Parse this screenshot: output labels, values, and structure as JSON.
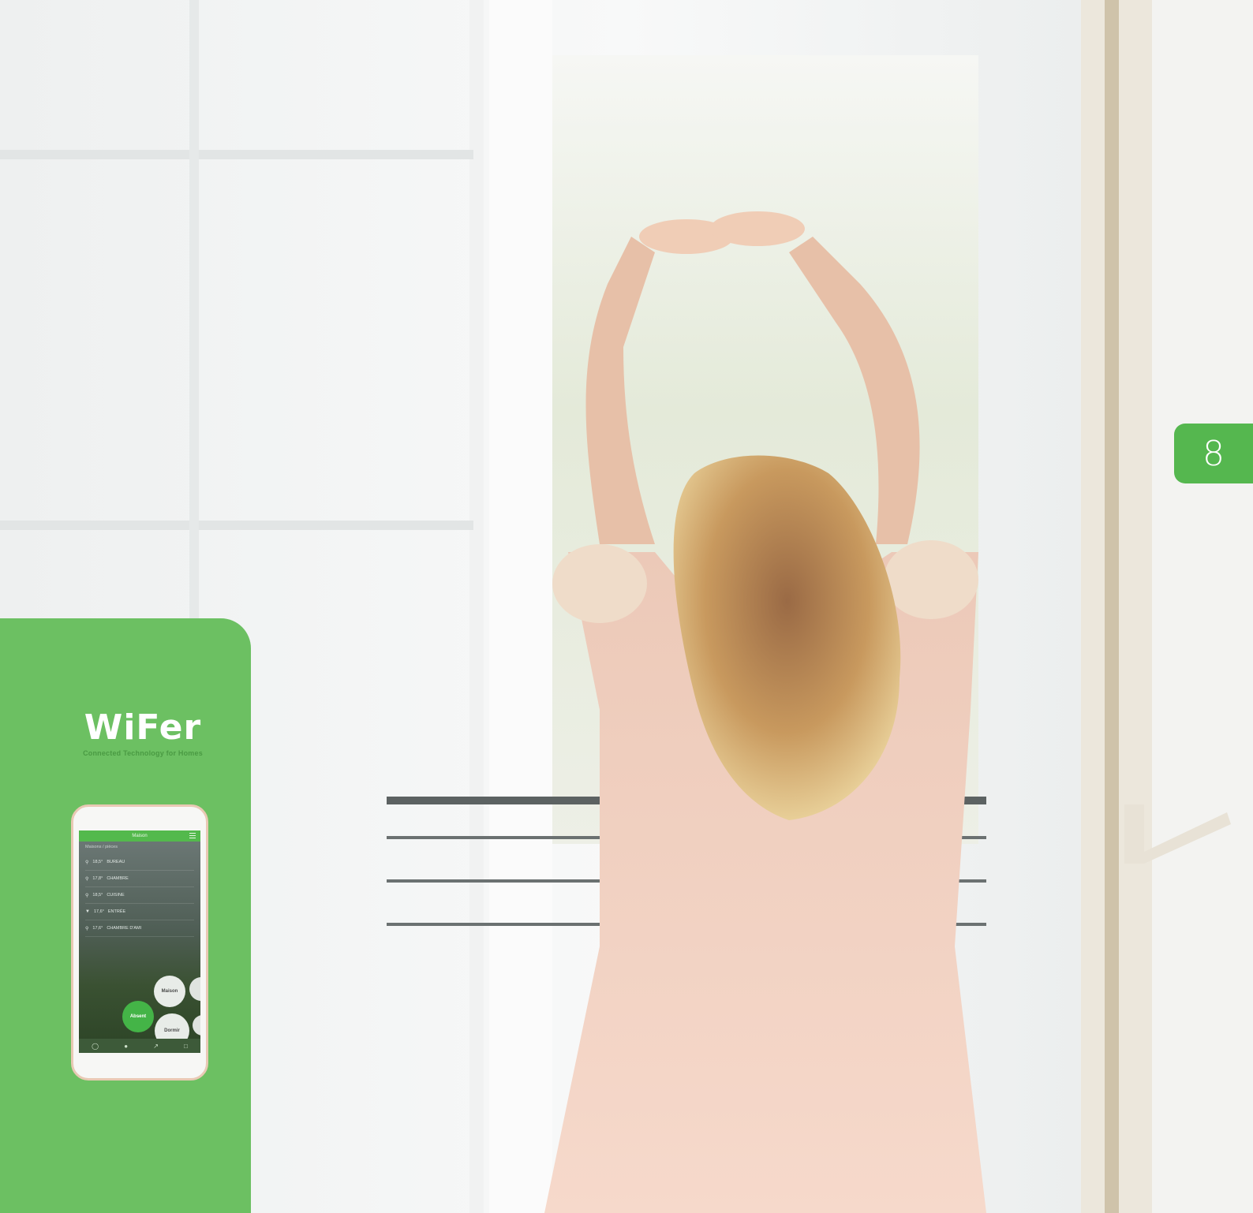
{
  "page": {
    "number": "8",
    "accent_color": "#55b74f",
    "panel_color": "#6cc062"
  },
  "photo": {
    "subject": "woman-stretching-at-window-icon"
  },
  "brand": {
    "name": "WiFer",
    "tagline": "Connected Technology for Homes"
  },
  "phone": {
    "header": "Maison",
    "list_heading": "Maisons / pièces",
    "rooms": [
      {
        "temp": "18,5°",
        "name": "BUREAU"
      },
      {
        "temp": "17,8°",
        "name": "CHAMBRE"
      },
      {
        "temp": "18,5°",
        "name": "CUISINE"
      },
      {
        "temp": "17,6°",
        "name": "ENTRÉE"
      },
      {
        "temp": "17,6°",
        "name": "CHAMBRE D'AMI"
      }
    ],
    "modes": {
      "maison": "Maison",
      "absent": "Absent",
      "dormir": "Dormir"
    },
    "tabs": [
      "home-icon",
      "rooms-icon",
      "chart-icon",
      "document-icon"
    ]
  }
}
